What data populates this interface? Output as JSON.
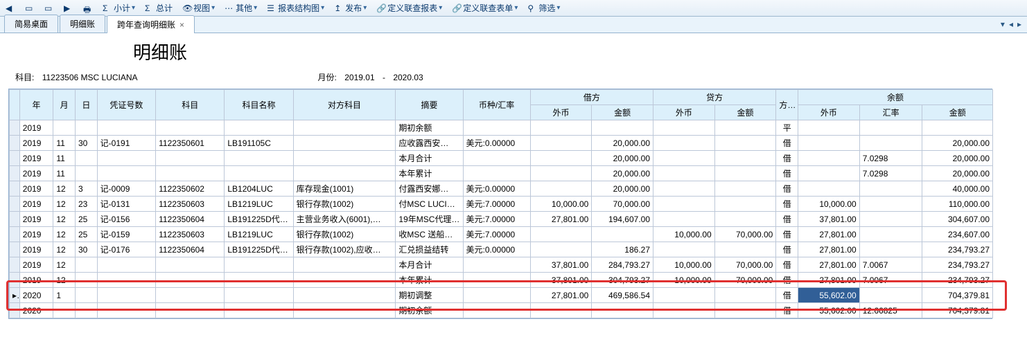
{
  "toolbar": {
    "items": [
      {
        "icon": "arrow-left-icon",
        "label": ""
      },
      {
        "icon": "doc-icon",
        "label": ""
      },
      {
        "icon": "doc2-icon",
        "label": ""
      },
      {
        "icon": "arrow-right-icon",
        "label": ""
      },
      {
        "icon": "printer-icon",
        "label": ""
      },
      {
        "icon": "subtotal-icon",
        "label": "小计"
      },
      {
        "icon": "total-icon",
        "label": "总计"
      },
      {
        "icon": "view-icon",
        "label": "视图"
      },
      {
        "icon": "other-icon",
        "label": "其他"
      },
      {
        "icon": "structure-icon",
        "label": "报表结构图"
      },
      {
        "icon": "publish-icon",
        "label": "发布"
      },
      {
        "icon": "link-report-icon",
        "label": "定义联查报表"
      },
      {
        "icon": "link-form-icon",
        "label": "定义联查表单"
      },
      {
        "icon": "filter-icon",
        "label": "筛选"
      }
    ]
  },
  "tabs": {
    "items": [
      {
        "label": "简易桌面",
        "active": false,
        "closable": false
      },
      {
        "label": "明细账",
        "active": false,
        "closable": false
      },
      {
        "label": "跨年查询明细账",
        "active": true,
        "closable": true
      }
    ]
  },
  "page": {
    "title": "明细账",
    "subject_label": "科目:",
    "subject_value": "11223506 MSC LUCIANA",
    "month_label": "月份:",
    "month_from": "2019.01",
    "month_sep": "-",
    "month_to": "2020.03"
  },
  "grid": {
    "headers_top": [
      "",
      "年",
      "月",
      "日",
      "凭证号数",
      "科目",
      "科目名称",
      "对方科目",
      "摘要",
      "币种/汇率",
      "借方",
      "贷方",
      "方向",
      "余额"
    ],
    "headers_sub_debit": [
      "外币",
      "金额"
    ],
    "headers_sub_credit": [
      "外币",
      "金额"
    ],
    "headers_sub_balance": [
      "外币",
      "汇率",
      "金额"
    ],
    "rows": [
      {
        "y": "2019",
        "m": "",
        "d": "",
        "vno": "",
        "acct": "",
        "aname": "",
        "opp": "",
        "sum": "期初余额",
        "cur": "",
        "dfc": "",
        "dam": "",
        "cfc": "",
        "cam": "",
        "dir": "平",
        "bfc": "",
        "brate": "",
        "bam": ""
      },
      {
        "y": "2019",
        "m": "11",
        "d": "30",
        "vno": "记-0191",
        "acct": "1122350601",
        "aname": "LB191105C",
        "opp": "",
        "sum": "应收露西安…",
        "cur": "美元:0.00000",
        "dfc": "",
        "dam": "20,000.00",
        "cfc": "",
        "cam": "",
        "dir": "借",
        "bfc": "",
        "brate": "",
        "bam": "20,000.00"
      },
      {
        "y": "2019",
        "m": "11",
        "d": "",
        "vno": "",
        "acct": "",
        "aname": "",
        "opp": "",
        "sum": "本月合计",
        "cur": "",
        "dfc": "",
        "dam": "20,000.00",
        "cfc": "",
        "cam": "",
        "dir": "借",
        "bfc": "",
        "brate": "7.0298",
        "bam": "20,000.00"
      },
      {
        "y": "2019",
        "m": "11",
        "d": "",
        "vno": "",
        "acct": "",
        "aname": "",
        "opp": "",
        "sum": "本年累计",
        "cur": "",
        "dfc": "",
        "dam": "20,000.00",
        "cfc": "",
        "cam": "",
        "dir": "借",
        "bfc": "",
        "brate": "7.0298",
        "bam": "20,000.00"
      },
      {
        "y": "2019",
        "m": "12",
        "d": "3",
        "vno": "记-0009",
        "acct": "1122350602",
        "aname": "LB1204LUC",
        "opp": "库存现金(1001)",
        "sum": "付露西安娜…",
        "cur": "美元:0.00000",
        "dfc": "",
        "dam": "20,000.00",
        "cfc": "",
        "cam": "",
        "dir": "借",
        "bfc": "",
        "brate": "",
        "bam": "40,000.00"
      },
      {
        "y": "2019",
        "m": "12",
        "d": "23",
        "vno": "记-0131",
        "acct": "1122350603",
        "aname": "LB1219LUC",
        "opp": "银行存款(1002)",
        "sum": "付MSC LUCIA…",
        "cur": "美元:7.00000",
        "dfc": "10,000.00",
        "dam": "70,000.00",
        "cfc": "",
        "cam": "",
        "dir": "借",
        "bfc": "10,000.00",
        "brate": "",
        "bam": "110,000.00"
      },
      {
        "y": "2019",
        "m": "12",
        "d": "25",
        "vno": "记-0156",
        "acct": "1122350604",
        "aname": "LB191225D代…",
        "opp": "主营业务收入(6001),…",
        "sum": "19年MSC代理…",
        "cur": "美元:7.00000",
        "dfc": "27,801.00",
        "dam": "194,607.00",
        "cfc": "",
        "cam": "",
        "dir": "借",
        "bfc": "37,801.00",
        "brate": "",
        "bam": "304,607.00"
      },
      {
        "y": "2019",
        "m": "12",
        "d": "25",
        "vno": "记-0159",
        "acct": "1122350603",
        "aname": "LB1219LUC",
        "opp": "银行存款(1002)",
        "sum": "收MSC 送船…",
        "cur": "美元:7.00000",
        "dfc": "",
        "dam": "",
        "cfc": "10,000.00",
        "cam": "70,000.00",
        "dir": "借",
        "bfc": "27,801.00",
        "brate": "",
        "bam": "234,607.00"
      },
      {
        "y": "2019",
        "m": "12",
        "d": "30",
        "vno": "记-0176",
        "acct": "1122350604",
        "aname": "LB191225D代…",
        "opp": "银行存款(1002),应收…",
        "sum": "汇兑损益结转",
        "cur": "美元:0.00000",
        "dfc": "",
        "dam": "186.27",
        "cfc": "",
        "cam": "",
        "dir": "借",
        "bfc": "27,801.00",
        "brate": "",
        "bam": "234,793.27"
      },
      {
        "y": "2019",
        "m": "12",
        "d": "",
        "vno": "",
        "acct": "",
        "aname": "",
        "opp": "",
        "sum": "本月合计",
        "cur": "",
        "dfc": "37,801.00",
        "dam": "284,793.27",
        "cfc": "10,000.00",
        "cam": "70,000.00",
        "dir": "借",
        "bfc": "27,801.00",
        "brate": "7.0067",
        "bam": "234,793.27"
      },
      {
        "y": "2019",
        "m": "12",
        "d": "",
        "vno": "",
        "acct": "",
        "aname": "",
        "opp": "",
        "sum": "本年累计",
        "cur": "",
        "dfc": "37,801.00",
        "dam": "304,793.27",
        "cfc": "10,000.00",
        "cam": "70,000.00",
        "dir": "借",
        "bfc": "27,801.00",
        "brate": "7.0067",
        "bam": "234,793.27"
      },
      {
        "y": "2020",
        "m": "1",
        "d": "",
        "vno": "",
        "acct": "",
        "aname": "",
        "opp": "",
        "sum": "期初调整",
        "cur": "",
        "dfc": "27,801.00",
        "dam": "469,586.54",
        "cfc": "",
        "cam": "",
        "dir": "借",
        "bfc": "55,602.00",
        "brate": "",
        "bam": "704,379.81",
        "highlight": true,
        "sel_bfc": true
      },
      {
        "y": "2020",
        "m": "",
        "d": "",
        "vno": "",
        "acct": "",
        "aname": "",
        "opp": "",
        "sum": "期初余额",
        "cur": "",
        "dfc": "",
        "dam": "",
        "cfc": "",
        "cam": "",
        "dir": "借",
        "bfc": "55,602.00",
        "brate": "12.66825",
        "bam": "704,379.81"
      }
    ]
  }
}
